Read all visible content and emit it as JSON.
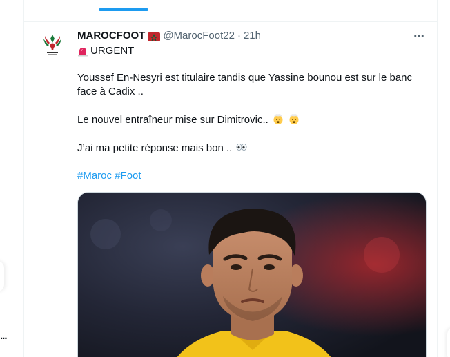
{
  "tweet": {
    "author": {
      "display_name": "MAROCFOOT",
      "handle": "@MarocFoot22",
      "time": "21h",
      "separator": "·"
    },
    "lines": {
      "urgent": "URGENT",
      "p1_a": "Youssef En-Nesyri  est titulaire tandis que Yassine bounou est sur le banc",
      "p1_b": "face à Cadix ..",
      "p2": "Le nouvel entraîneur mise sur Dimitrovic..",
      "p3": "J’ai ma petite réponse mais bon .."
    },
    "hashtags": [
      "#Maroc",
      "#Foot"
    ]
  },
  "left_edge": {
    "dots": "..."
  },
  "colors": {
    "accent": "#1d9bf0",
    "text": "#0f1419",
    "secondary": "#536471",
    "border": "#eff3f4"
  },
  "icons": {
    "flag": "morocco-flag-icon",
    "urgent": "siren-icon",
    "shock": "exploding-head-icon",
    "eyes": "eyes-icon",
    "more": "more-horizontal-icon"
  }
}
